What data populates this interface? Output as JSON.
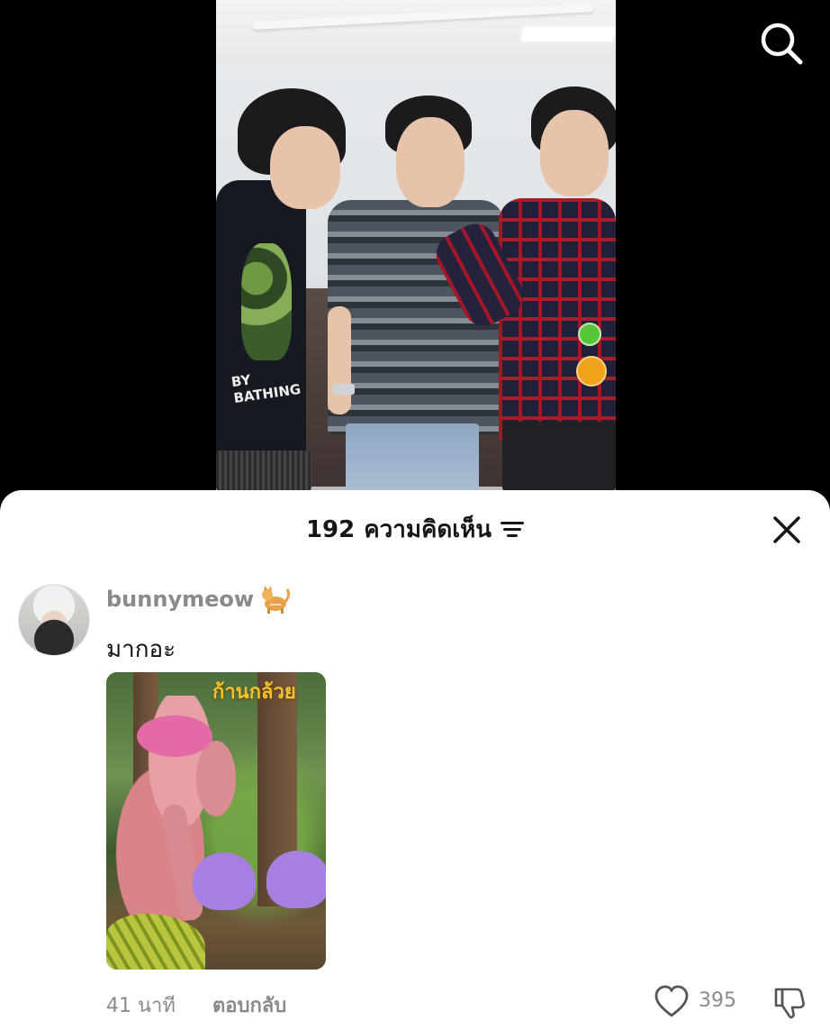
{
  "header": {
    "comment_count": "192",
    "comments_label": "ความคิดเห็น"
  },
  "comment": {
    "username": "bunnymeow",
    "text": "มากอะ",
    "time": "41 นาที",
    "reply_label": "ตอบกลับ",
    "like_count": "395",
    "image_title": "ก้านกล้วย"
  },
  "icons": {
    "search": "search-icon",
    "filter": "filter-icon",
    "close": "close-icon",
    "like": "heart-icon",
    "dislike": "thumbs-down-icon",
    "username_emoji": "cat-icon"
  },
  "colors": {
    "sheet_bg": "#ffffff",
    "backdrop": "#000000",
    "muted_text": "#8a8a8a",
    "primary_text": "#161616"
  }
}
